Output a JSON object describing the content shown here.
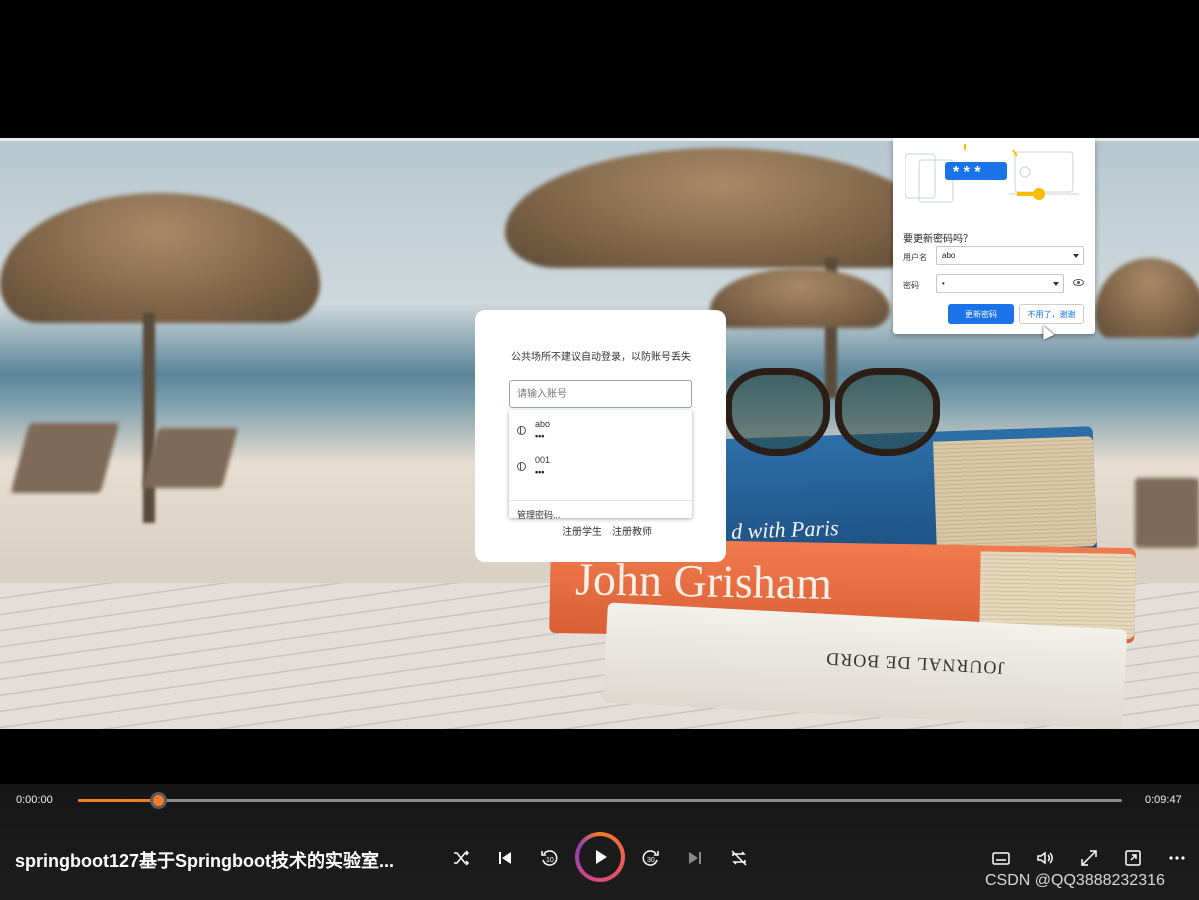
{
  "login": {
    "tip": "公共场所不建议自动登录，以防账号丢失",
    "account_placeholder": "请输入账号",
    "saved_passwords": [
      {
        "username": "abo",
        "password_mask": "•••"
      },
      {
        "username": "001",
        "password_mask": "•••"
      }
    ],
    "manage_passwords_label": "管理密码...",
    "register_student_label": "注册学生",
    "register_teacher_label": "注册教师"
  },
  "password_popup": {
    "question": "要更新密码吗？",
    "username_label": "用户名",
    "username_value": "abo",
    "password_label": "密码",
    "password_value": "•",
    "update_button_label": "更新密码",
    "no_thanks_button_label": "不用了，谢谢",
    "stars": "* * *"
  },
  "scene_text": {
    "book_orange_title": "John Grisham",
    "book_blue_title": "d with Paris",
    "book_white_title": "JOURNAL DE BORD"
  },
  "player": {
    "current_time": "0:00:00",
    "total_time": "0:09:47",
    "progress": 0.077,
    "title": "springboot127基于Springboot技术的实验室...",
    "accent_color": "#f47c26"
  },
  "watermark": "CSDN @QQ3888232316",
  "icons": [
    "shuffle-icon",
    "previous-icon",
    "rewind-10-icon",
    "play-icon",
    "forward-30-icon",
    "next-icon",
    "repeat-icon",
    "subtitles-icon",
    "volume-icon",
    "fullscreen-icon",
    "miniplayer-icon",
    "more-icon",
    "globe-icon",
    "eye-icon"
  ]
}
